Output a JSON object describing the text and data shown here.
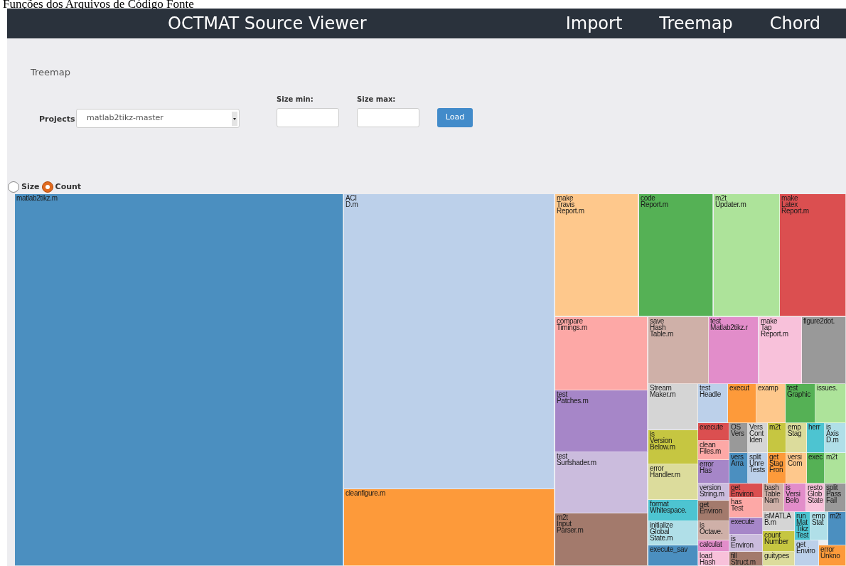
{
  "page_title": "Funções dos Arquivos de Código Fonte",
  "header": {
    "title": "OCTMAT Source Viewer",
    "nav": [
      "Import",
      "Treemap",
      "Chord"
    ]
  },
  "section_title": "Treemap",
  "form": {
    "projects_label": "Projects",
    "project": "matlab2tikz-master",
    "size_min": {
      "label": "Size min:"
    },
    "size_max": {
      "label": "Size max:"
    },
    "load": "Load"
  },
  "view_mode": [
    {
      "label": "Size",
      "selected": false
    },
    {
      "label": "Count",
      "selected": true
    }
  ],
  "treemap": {
    "cells": [
      {
        "lines": [
          "matlab2tikz.m"
        ],
        "color": "#4b8fc0"
      },
      {
        "lines": [
          "ACI",
          "D.m"
        ],
        "color": "#bcd0ea"
      },
      {
        "lines": [
          "cleanfigure.m"
        ],
        "color": "#fd9a3a"
      },
      {
        "lines": [
          "make",
          "Travis",
          "Report.m"
        ],
        "color": "#fec88c"
      },
      {
        "lines": [
          "code",
          "Report.m"
        ],
        "color": "#55b155"
      },
      {
        "lines": [
          "m2t",
          "Updater.m"
        ],
        "color": "#ade39a"
      },
      {
        "lines": [
          "make",
          "Latex",
          "Report.m"
        ],
        "color": "#db4f50"
      },
      {
        "lines": [
          "compare",
          "Timings.m"
        ],
        "color": "#fda8a6"
      },
      {
        "lines": [
          "save",
          "Hash",
          "Table.m"
        ],
        "color": "#cfb0a8"
      },
      {
        "lines": [
          "test",
          "Matlab2tikz.r"
        ],
        "color": "#e28dca"
      },
      {
        "lines": [
          "make",
          "Tap",
          "Report.m"
        ],
        "color": "#f8c1da"
      },
      {
        "lines": [
          "figure2dot."
        ],
        "color": "#999999"
      },
      {
        "lines": [
          "test",
          "Patches.m"
        ],
        "color": "#a686c8"
      },
      {
        "lines": [
          "test",
          "Surfshader.m"
        ],
        "color": "#cbbcdd"
      },
      {
        "lines": [
          "m2t",
          "Input",
          "Parser.m"
        ],
        "color": "#a37a6c"
      },
      {
        "lines": [
          "Stream",
          "Maker.m"
        ],
        "color": "#d5d5d5"
      },
      {
        "lines": [
          "is",
          "Version",
          "Below.m"
        ],
        "color": "#c6c641"
      },
      {
        "lines": [
          "error",
          "Handler.m"
        ],
        "color": "#dcdc9c"
      },
      {
        "lines": [
          "format",
          "Whitespace."
        ],
        "color": "#4dc4d1"
      },
      {
        "lines": [
          "initialize",
          "Global",
          "State.m"
        ],
        "color": "#b0dfe8"
      },
      {
        "lines": [
          "execute_sav"
        ],
        "color": "#4b8fc0"
      },
      {
        "lines": [
          "test",
          "Headle"
        ],
        "color": "#bcd0ea"
      },
      {
        "lines": [
          "execut"
        ],
        "color": "#fd9a3a"
      },
      {
        "lines": [
          "examp"
        ],
        "color": "#fec88c"
      },
      {
        "lines": [
          "test",
          "Graphic"
        ],
        "color": "#55b155"
      },
      {
        "lines": [
          "issues."
        ],
        "color": "#ade39a"
      },
      {
        "lines": [
          "execute"
        ],
        "color": "#db4f50"
      },
      {
        "lines": [
          "clean",
          "Files.m"
        ],
        "color": "#fda8a6"
      },
      {
        "lines": [
          "error",
          "Has"
        ],
        "color": "#a686c8"
      },
      {
        "lines": [
          "version",
          "String.m"
        ],
        "color": "#cbbcdd"
      },
      {
        "lines": [
          "get",
          "Environ"
        ],
        "color": "#a37a6c"
      },
      {
        "lines": [
          "is",
          "Octave."
        ],
        "color": "#cfb0a8"
      },
      {
        "lines": [
          "calculat"
        ],
        "color": "#e28dca"
      },
      {
        "lines": [
          "load",
          "Hash"
        ],
        "color": "#f8c1da"
      },
      {
        "lines": [
          "OS",
          "Vers"
        ],
        "color": "#999999"
      },
      {
        "lines": [
          "Vers",
          "Cont",
          "Iden"
        ],
        "color": "#d5d5d5"
      },
      {
        "lines": [
          "m2t"
        ],
        "color": "#c6c641"
      },
      {
        "lines": [
          "emp",
          "Stag"
        ],
        "color": "#dcdc9c"
      },
      {
        "lines": [
          "herr"
        ],
        "color": "#4dc4d1"
      },
      {
        "lines": [
          "is",
          "Axis",
          "D.m"
        ],
        "color": "#b0dfe8"
      },
      {
        "lines": [
          "vers",
          "Arra"
        ],
        "color": "#4b8fc0"
      },
      {
        "lines": [
          "split",
          "Unre",
          "Tests"
        ],
        "color": "#bcd0ea"
      },
      {
        "lines": [
          "get",
          "Stag",
          "Fron"
        ],
        "color": "#fd9a3a"
      },
      {
        "lines": [
          "versi",
          "Com"
        ],
        "color": "#fec88c"
      },
      {
        "lines": [
          "exec"
        ],
        "color": "#55b155"
      },
      {
        "lines": [
          "m2t"
        ],
        "color": "#ade39a"
      },
      {
        "lines": [
          "get",
          "Environ"
        ],
        "color": "#db4f50"
      },
      {
        "lines": [
          "has",
          "Test"
        ],
        "color": "#fda8a6"
      },
      {
        "lines": [
          "execute"
        ],
        "color": "#a686c8"
      },
      {
        "lines": [
          "is",
          "Environ"
        ],
        "color": "#cbbcdd"
      },
      {
        "lines": [
          "fill",
          "Struct.m"
        ],
        "color": "#a37a6c"
      },
      {
        "lines": [
          "bash",
          "Table",
          "Nam"
        ],
        "color": "#cfb0a8"
      },
      {
        "lines": [
          "is",
          "Versi",
          "Belo"
        ],
        "color": "#e28dca"
      },
      {
        "lines": [
          "resto",
          "Glob",
          "State"
        ],
        "color": "#f8c1da"
      },
      {
        "lines": [
          "split",
          "Pass",
          "Fail"
        ],
        "color": "#999999"
      },
      {
        "lines": [
          "isMATLA",
          "B.m"
        ],
        "color": "#d5d5d5"
      },
      {
        "lines": [
          "count",
          "Number"
        ],
        "color": "#c6c641"
      },
      {
        "lines": [
          "guitypes"
        ],
        "color": "#dcdc9c"
      },
      {
        "lines": [
          "run",
          "Mat",
          "Tikz",
          "Test"
        ],
        "color": "#4dc4d1"
      },
      {
        "lines": [
          "emp",
          "Stat"
        ],
        "color": "#b0dfe8"
      },
      {
        "lines": [
          "m2t"
        ],
        "color": "#4b8fc0"
      },
      {
        "lines": [
          "get",
          "Enviro"
        ],
        "color": "#bcd0ea"
      },
      {
        "lines": [
          "error",
          "Unkno"
        ],
        "color": "#fd9a3a"
      }
    ]
  }
}
